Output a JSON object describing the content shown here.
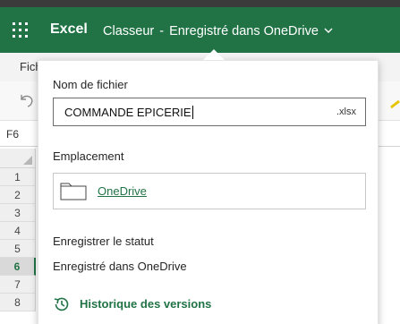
{
  "header": {
    "app_name": "Excel",
    "doc_name": "Classeur",
    "separator": "-",
    "save_state": "Enregistré dans OneDrive",
    "app_launcher_icon": "waffle-grid-icon",
    "chevron_icon": "chevron-down-icon",
    "brand_color": "#217346"
  },
  "ribbon": {
    "first_tab": "Fichier"
  },
  "toolbar": {
    "undo_icon": "undo-icon"
  },
  "formula_bar": {
    "name_box": "F6"
  },
  "grid": {
    "row_numbers": [
      "1",
      "2",
      "3",
      "4",
      "5",
      "6",
      "7",
      "8"
    ],
    "active_row": "6"
  },
  "save_panel": {
    "filename_label": "Nom de fichier",
    "filename_value": "COMMANDE EPICERIE",
    "extension": ".xlsx",
    "location_label": "Emplacement",
    "location_value": "OneDrive",
    "folder_icon": "folder-icon",
    "status_label": "Enregistrer le statut",
    "status_value": "Enregistré dans OneDrive",
    "history_label": "Historique des versions",
    "history_icon": "history-clock-icon"
  }
}
